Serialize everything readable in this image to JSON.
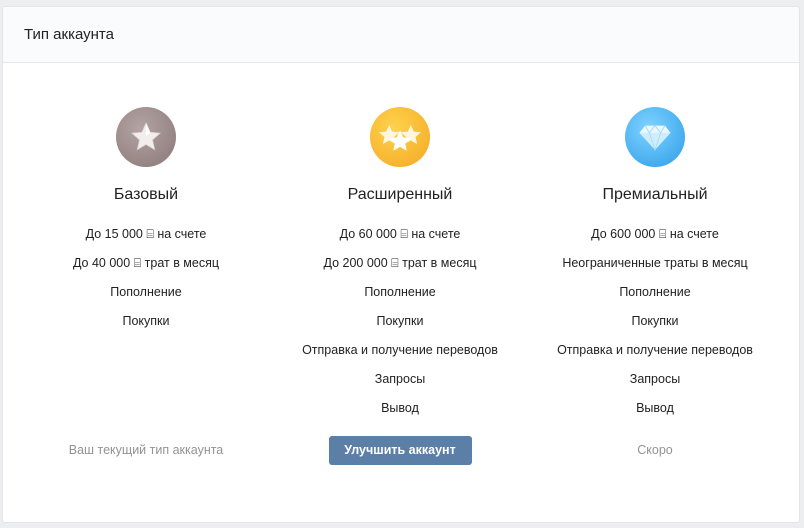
{
  "header": {
    "title": "Тип аккаунта"
  },
  "tiers": [
    {
      "name": "Базовый",
      "icon": "silver-star-icon",
      "features": [
        "До 15 000 ⌸ на счете",
        "До 40 000 ⌸ трат в месяц",
        "Пополнение",
        "Покупки"
      ],
      "status": "Ваш текущий тип аккаунта"
    },
    {
      "name": "Расширенный",
      "icon": "gold-stars-icon",
      "features": [
        "До 60 000 ⌸ на счете",
        "До 200 000 ⌸ трат в месяц",
        "Пополнение",
        "Покупки",
        "Отправка и получение переводов",
        "Запросы",
        "Вывод"
      ],
      "action": "Улучшить аккаунт"
    },
    {
      "name": "Премиальный",
      "icon": "diamond-icon",
      "features": [
        "До 600 000 ⌸ на счете",
        "Неограниченные траты в месяц",
        "Пополнение",
        "Покупки",
        "Отправка и получение переводов",
        "Запросы",
        "Вывод"
      ],
      "status": "Скоро"
    }
  ],
  "colors": {
    "accent_button": "#5b7fa6",
    "muted_text": "#939393"
  }
}
